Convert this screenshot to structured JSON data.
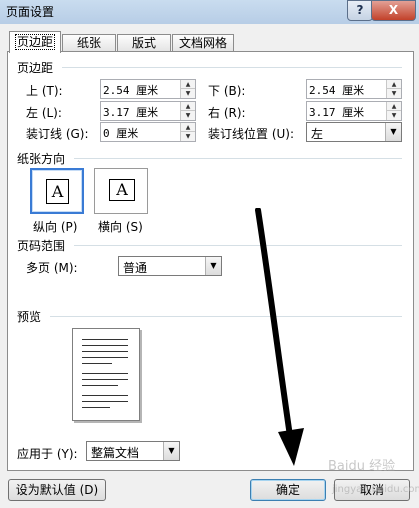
{
  "window": {
    "title": "页面设置",
    "help_symbol": "?",
    "close_symbol": "X"
  },
  "tabs": [
    {
      "label": "页边距",
      "active": true
    },
    {
      "label": "纸张",
      "active": false
    },
    {
      "label": "版式",
      "active": false
    },
    {
      "label": "文档网格",
      "active": false
    }
  ],
  "margins": {
    "heading": "页边距",
    "top_label": "上 (T):",
    "top_value": "2.54 厘米",
    "bottom_label": "下 (B):",
    "bottom_value": "2.54 厘米",
    "left_label": "左 (L):",
    "left_value": "3.17 厘米",
    "right_label": "右 (R):",
    "right_value": "3.17 厘米",
    "gutter_label": "装订线 (G):",
    "gutter_value": "0 厘米",
    "gutter_pos_label": "装订线位置 (U):",
    "gutter_pos_value": "左"
  },
  "orientation": {
    "heading": "纸张方向",
    "icon_letter": "A",
    "portrait_label": "纵向 (P)",
    "landscape_label": "横向 (S)",
    "selected": "portrait"
  },
  "pages": {
    "heading": "页码范围",
    "multiple_label": "多页 (M):",
    "multiple_value": "普通"
  },
  "preview": {
    "heading": "预览",
    "apply_label": "应用于 (Y):",
    "apply_value": "整篇文档"
  },
  "buttons": {
    "default_label": "设为默认值 (D)",
    "ok_label": "确定",
    "cancel_label": "取消"
  },
  "watermark": {
    "line1": "Baidu 经验",
    "line2": "jingyan.baidu.com"
  },
  "icons": {
    "spin_up": "▲",
    "spin_down": "▼",
    "dropdown": "▼"
  }
}
